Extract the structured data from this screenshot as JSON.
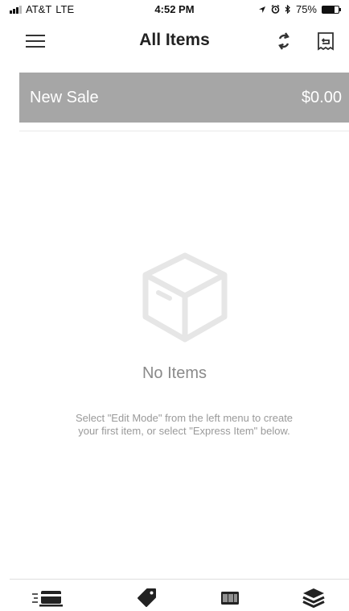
{
  "status_bar": {
    "carrier": "AT&T",
    "network": "LTE",
    "time": "4:52 PM",
    "battery": "75%",
    "battery_level": 0.75,
    "icons": [
      "signal-icon",
      "location-icon",
      "alarm-icon",
      "bluetooth-icon",
      "battery-icon"
    ]
  },
  "nav": {
    "title": "All Items",
    "icons": {
      "menu": "hamburger-menu-icon",
      "sync": "sync-icon",
      "receipt": "receipt-icon"
    }
  },
  "sale": {
    "label": "New Sale",
    "amount": "$0.00"
  },
  "empty_state": {
    "icon": "box-icon",
    "title": "No Items",
    "description": "Select \"Edit Mode\" from the left menu to create your first item, or select \"Express Item\" below."
  },
  "tabs": [
    {
      "icon": "card-swipe-icon"
    },
    {
      "icon": "tag-icon"
    },
    {
      "icon": "barcode-icon"
    },
    {
      "icon": "layers-icon"
    }
  ],
  "colors": {
    "sale_bar": "#a6a6a6",
    "empty_text": "#8a8a8a",
    "icon_dark": "#333333"
  }
}
